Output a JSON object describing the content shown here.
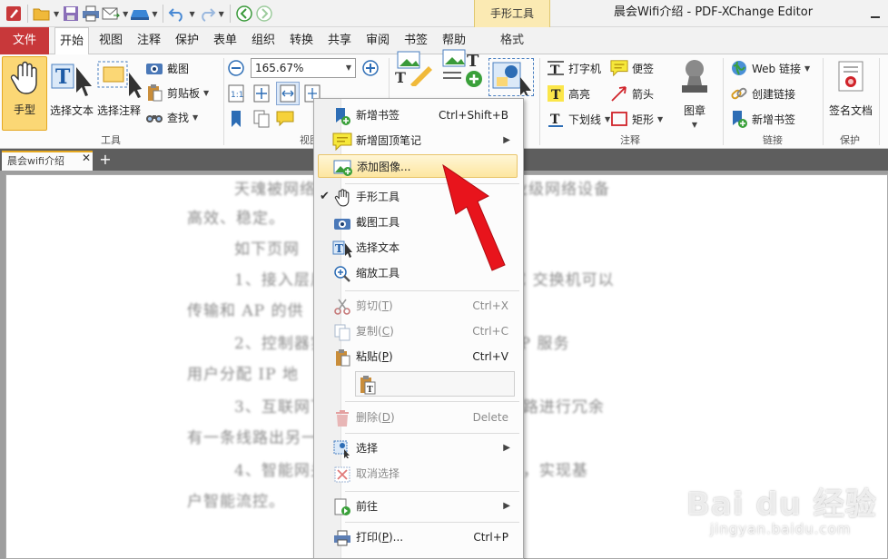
{
  "window": {
    "title": "晨会Wifi介绍 - PDF-XChange Editor"
  },
  "context_group": {
    "title": "手形工具",
    "tab": "格式"
  },
  "tabs": [
    {
      "label": "文件"
    },
    {
      "label": "开始"
    },
    {
      "label": "视图"
    },
    {
      "label": "注释"
    },
    {
      "label": "保护"
    },
    {
      "label": "表单"
    },
    {
      "label": "组织"
    },
    {
      "label": "转换"
    },
    {
      "label": "共享"
    },
    {
      "label": "审阅"
    },
    {
      "label": "书签"
    },
    {
      "label": "帮助"
    }
  ],
  "ribbon": {
    "tools": {
      "hand": "手型",
      "select_text": "选择文本",
      "select_annot": "选择注释",
      "snapshot": "截图",
      "clipboard": "剪贴板",
      "find": "查找",
      "group": "工具"
    },
    "view": {
      "zoom": "165.67%",
      "group": "视图"
    },
    "annot": {
      "typewriter": "打字机",
      "sticky": "便签",
      "highlight": "高亮",
      "arrow": "箭头",
      "underline": "下划线",
      "rect": "矩形",
      "group": "注释"
    },
    "stamp": {
      "label": "图章"
    },
    "links": {
      "web_link": "Web 链接",
      "create_link": "创建链接",
      "add_bookmark": "新增书签",
      "group": "链接"
    },
    "protect": {
      "sign": "签名文档",
      "group": "保护"
    }
  },
  "doc": {
    "tab_title": "晨会wifi介绍",
    "lines": [
      "天魂被网络支撑，本次方案全部使用企业级网络设备",
      "高效、稳定。",
      "如下页网",
      "1、接入层用企业级 POE 交换机，POE 交换机可以",
      "传输和 AP 的供",
      "2、控制器实现高速转发，高性能 DHCP 服务",
      "用户分配 IP 地",
      "3、互联网下对等双运营商线路，两条线路进行冗余",
      "有一条线路出另一条线路。",
      "4、智能网关设备可以识别用户以及流量，实现基",
      "户智能流控。"
    ]
  },
  "menu": {
    "items": [
      {
        "label": "新增书签",
        "shortcut": "Ctrl+Shift+B"
      },
      {
        "label": "新增固顶笔记"
      },
      {
        "label": "添加图像..."
      },
      {
        "label": "手形工具"
      },
      {
        "label": "截图工具"
      },
      {
        "label": "选择文本"
      },
      {
        "label": "缩放工具"
      },
      {
        "label": "剪切",
        "mnemonic": "T",
        "shortcut": "Ctrl+X"
      },
      {
        "label": "复制",
        "mnemonic": "C",
        "shortcut": "Ctrl+C"
      },
      {
        "label": "粘贴",
        "mnemonic": "P",
        "shortcut": "Ctrl+V"
      },
      {
        "label": "删除",
        "mnemonic": "D",
        "shortcut": "Delete"
      },
      {
        "label": "选择"
      },
      {
        "label": "取消选择"
      },
      {
        "label": "前往"
      },
      {
        "label": "打印",
        "mnemonic": "P",
        "suffix": "...",
        "shortcut": "Ctrl+P"
      }
    ]
  },
  "watermark": {
    "brand": "Bai du 经验",
    "url": "jingyan.baidu.com"
  },
  "colors": {
    "file_tab": "#c8383a",
    "accent": "#e5a821",
    "arrow": "#e8141c"
  }
}
